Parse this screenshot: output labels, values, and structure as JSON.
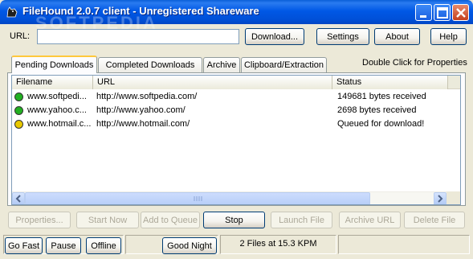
{
  "window": {
    "title": "FileHound 2.0.7 client - Unregistered Shareware",
    "watermark": "SOFTPEDIA",
    "controls": {
      "minimize": "minimize",
      "maximize": "maximize",
      "close": "close"
    }
  },
  "toolbar": {
    "url_label": "URL:",
    "url_value": "",
    "download_label": "Download...",
    "settings_label": "Settings",
    "about_label": "About",
    "help_label": "Help"
  },
  "tabs": [
    {
      "label": "Pending Downloads",
      "active": true
    },
    {
      "label": "Completed Downloads",
      "active": false
    },
    {
      "label": "Archive",
      "active": false
    },
    {
      "label": "Clipboard/Extraction",
      "active": false
    }
  ],
  "hint": "Double Click for Properties",
  "table": {
    "columns": [
      "Filename",
      "URL",
      "Status"
    ],
    "rows": [
      {
        "filename": "www.softpedi...",
        "url": "http://www.softpedia.com/",
        "status": "149681 bytes received",
        "state": "active",
        "color": "#22b022"
      },
      {
        "filename": "www.yahoo.c...",
        "url": "http://www.yahoo.com/",
        "status": "2698 bytes received",
        "state": "active",
        "color": "#22b022"
      },
      {
        "filename": "www.hotmail.c...",
        "url": "http://www.hotmail.com/",
        "status": "Queued for download!",
        "state": "queued",
        "color": "#e8c800"
      }
    ]
  },
  "actions": {
    "properties": "Properties...",
    "start_now": "Start Now",
    "add_to_queue": "Add to Queue",
    "stop": "Stop",
    "launch_file": "Launch File",
    "archive_url": "Archive URL",
    "delete_file": "Delete File"
  },
  "bottom": {
    "go_fast": "Go Fast",
    "pause": "Pause",
    "offline": "Offline",
    "good_night": "Good Night",
    "status": "2 Files at 15.3 KPM"
  },
  "colors": {
    "titlebar": "#0058e6",
    "window_bg": "#ece9d8",
    "active_dot": "#22b022",
    "queued_dot": "#e8c800",
    "tab_highlight": "#ffc83c"
  }
}
